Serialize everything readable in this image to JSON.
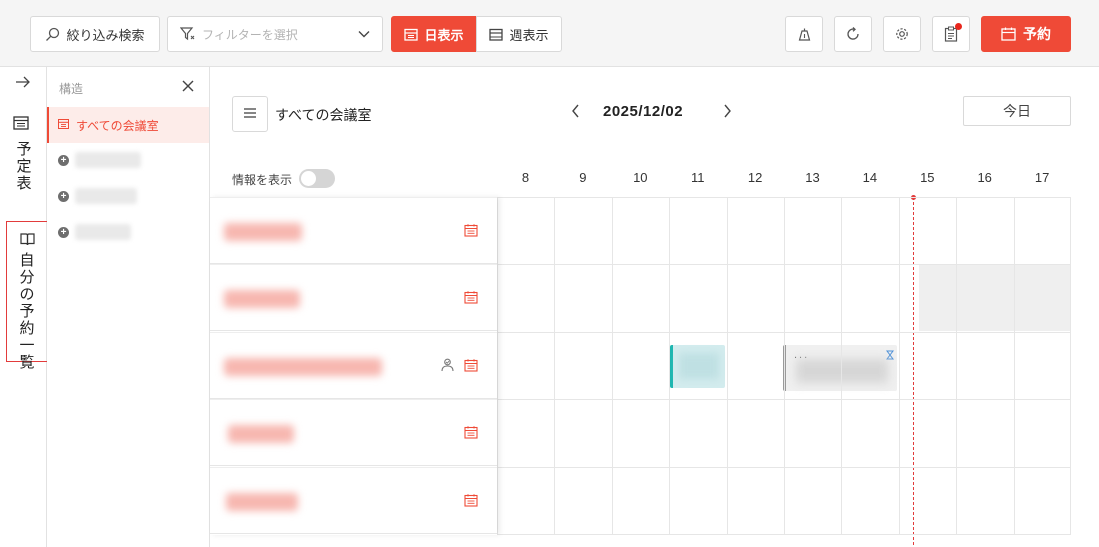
{
  "toolbar": {
    "search_label": "絞り込み検索",
    "filter_placeholder": "フィルターを選択",
    "day_view_label": "日表示",
    "week_view_label": "週表示",
    "reserve_label": "予約"
  },
  "rail": {
    "schedule_label": "予定表",
    "my_reservations_label": "自分の予約一覧"
  },
  "structure": {
    "title": "構造",
    "all_rooms_label": "すべての会議室"
  },
  "main": {
    "room_title": "すべての会議室",
    "date": "2025/12/02",
    "today_label": "今日",
    "info_toggle_label": "情報を表示",
    "hours": [
      "8",
      "9",
      "10",
      "11",
      "12",
      "13",
      "14",
      "15",
      "16",
      "17"
    ]
  },
  "booking": {
    "second_dots": "..."
  },
  "colors": {
    "accent": "#ef4a37",
    "teal": "#1eb6b0",
    "now_line": "#e23b3b"
  }
}
